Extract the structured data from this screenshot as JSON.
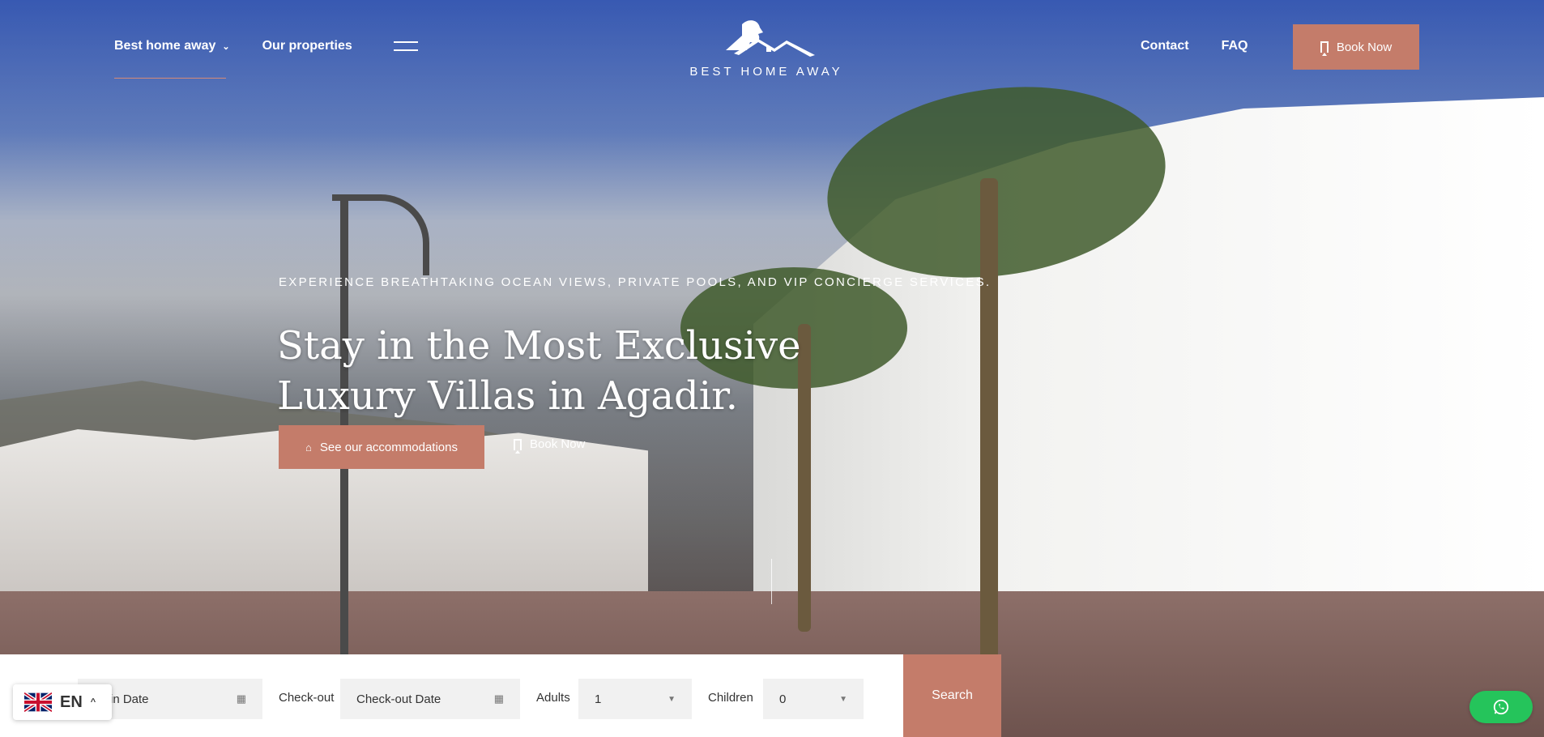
{
  "header": {
    "nav_left": [
      "Best home away",
      "Our properties"
    ],
    "logo_text": "BEST HOME AWAY",
    "nav_right": [
      "Contact",
      "FAQ"
    ],
    "book_now": "Book Now"
  },
  "hero": {
    "eyebrow": "EXPERIENCE BREATHTAKING OCEAN VIEWS, PRIVATE POOLS, AND VIP CONCIERGE SERVICES.",
    "headline": "Stay in the Most Exclusive Luxury Villas in Agadir.",
    "cta_primary": "See our accommodations",
    "cta_secondary": "Book Now"
  },
  "booking": {
    "checkin_value": "ck-in Date",
    "checkout_label": "Check-out",
    "checkout_placeholder": "Check-out Date",
    "adults_label": "Adults",
    "adults_value": "1",
    "children_label": "Children",
    "children_value": "0",
    "search_label": "Search"
  },
  "language": {
    "code": "EN"
  },
  "colors": {
    "accent": "#c47c6a",
    "whatsapp": "#25c45b"
  },
  "icons": [
    "chevron-down-icon",
    "hamburger-icon",
    "bookmark-icon",
    "house-icon",
    "calendar-icon",
    "caret-down-icon",
    "uk-flag-icon",
    "chevron-up-icon",
    "whatsapp-icon"
  ]
}
